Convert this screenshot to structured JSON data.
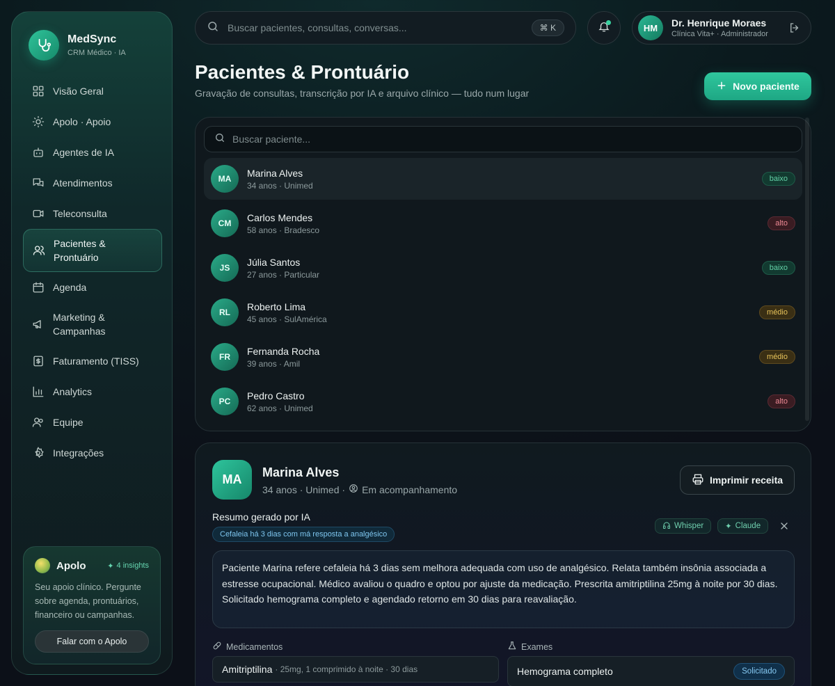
{
  "brand": {
    "name": "MedSync",
    "sub": "CRM Médico · IA"
  },
  "nav": [
    {
      "label": "Visão Geral",
      "icon": "grid-icon"
    },
    {
      "label": "Apolo · Apoio",
      "icon": "sun-icon"
    },
    {
      "label": "Agentes de IA",
      "icon": "robot-icon"
    },
    {
      "label": "Atendimentos",
      "icon": "chat-icon"
    },
    {
      "label": "Teleconsulta",
      "icon": "video-icon"
    },
    {
      "label": "Pacientes & Prontuário",
      "icon": "users-icon",
      "active": true
    },
    {
      "label": "Agenda",
      "icon": "calendar-icon"
    },
    {
      "label": "Marketing & Campanhas",
      "icon": "megaphone-icon"
    },
    {
      "label": "Faturamento (TISS)",
      "icon": "receipt-icon"
    },
    {
      "label": "Analytics",
      "icon": "bar-chart-icon"
    },
    {
      "label": "Equipe",
      "icon": "team-icon"
    },
    {
      "label": "Integrações",
      "icon": "gear-icon"
    }
  ],
  "apolo": {
    "title": "Apolo",
    "badge": "4 insights",
    "text": "Seu apoio clínico. Pergunte sobre agenda, prontuários, financeiro ou campanhas.",
    "button": "Falar com o Apolo"
  },
  "topbar": {
    "search_placeholder": "Buscar pacientes, consultas, conversas...",
    "shortcut": "⌘  K",
    "user": {
      "initials": "HM",
      "name": "Dr. Henrique Moraes",
      "sub": "Clínica Vita+ · Administrador"
    }
  },
  "header": {
    "title": "Pacientes & Prontuário",
    "subtitle": "Gravação de consultas, transcrição por IA e arquivo clínico — tudo num lugar",
    "new_button": "Novo paciente"
  },
  "list": {
    "search_placeholder": "Buscar paciente...",
    "patients": [
      {
        "initials": "MA",
        "name": "Marina Alves",
        "meta": "34 anos · Unimed",
        "risk": "baixo",
        "risk_class": "baixo"
      },
      {
        "initials": "CM",
        "name": "Carlos Mendes",
        "meta": "58 anos · Bradesco",
        "risk": "alto",
        "risk_class": "alto"
      },
      {
        "initials": "JS",
        "name": "Júlia Santos",
        "meta": "27 anos · Particular",
        "risk": "baixo",
        "risk_class": "baixo"
      },
      {
        "initials": "RL",
        "name": "Roberto Lima",
        "meta": "45 anos · SulAmérica",
        "risk": "médio",
        "risk_class": "medio"
      },
      {
        "initials": "FR",
        "name": "Fernanda Rocha",
        "meta": "39 anos · Amil",
        "risk": "médio",
        "risk_class": "medio"
      },
      {
        "initials": "PC",
        "name": "Pedro Castro",
        "meta": "62 anos · Unimed",
        "risk": "alto",
        "risk_class": "alto"
      }
    ]
  },
  "detail": {
    "initials": "MA",
    "name": "Marina Alves",
    "meta_prefix": "34 anos · Unimed ·",
    "status": "Em acompanhamento",
    "print_button": "Imprimir receita",
    "summary_title": "Resumo gerado por IA",
    "summary_chip": "Cefaleia há 3 dias com má resposta a analgésico",
    "tags": [
      "Whisper",
      "Claude"
    ],
    "summary_text": "Paciente Marina refere cefaleia há 3 dias sem melhora adequada com uso de analgésico. Relata também insônia associada a estresse ocupacional. Médico avaliou o quadro e optou por ajuste da medicação. Prescrita amitriptilina 25mg à noite por 30 dias. Solicitado hemograma completo e agendado retorno em 30 dias para reavaliação.",
    "meds_title": "Medicamentos",
    "med_name": "Amitriptilina",
    "med_detail": "· 25mg, 1 comprimido à noite · 30 dias",
    "exams_title": "Exames",
    "exam_name": "Hemograma completo",
    "exam_status": "Solicitado"
  }
}
